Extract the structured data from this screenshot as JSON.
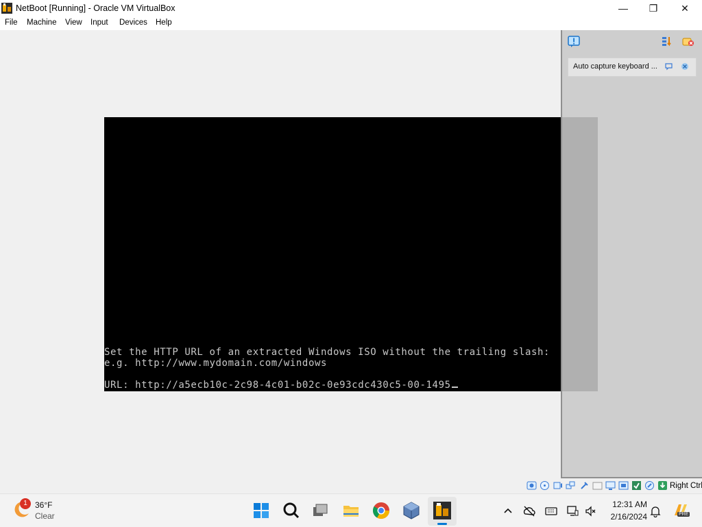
{
  "window": {
    "title": "NetBoot [Running] - Oracle VM VirtualBox",
    "minimize_glyph": "—",
    "maximize_glyph": "❐",
    "close_glyph": "✕"
  },
  "menu": [
    "File",
    "Machine",
    "View",
    "Input",
    "Devices",
    "Help"
  ],
  "console": {
    "line1": "Set the HTTP URL of an extracted Windows ISO without the trailing slash:",
    "line2": "e.g. http://www.mydomain.com/windows",
    "url_prompt": "URL: ",
    "url_value": "http://a5ecb10c-2c98-4c01-b02c-0e93cdc430c5-00-1495"
  },
  "notification_panel": {
    "message": "Auto capture keyboard ..."
  },
  "statusbar": {
    "host_key": "Right Ctrl"
  },
  "taskbar": {
    "weather": {
      "badge": "1",
      "temperature": "36°F",
      "condition": "Clear"
    },
    "clock": {
      "time": "12:31 AM",
      "date": "2/16/2024"
    },
    "copilot_badge": "PRE"
  },
  "colors": {
    "console_text": "#c8c8c8",
    "accent": "#0078d4"
  }
}
